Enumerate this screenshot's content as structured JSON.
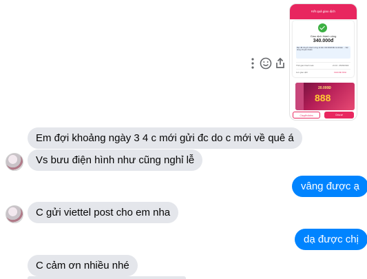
{
  "shared_image": {
    "header_title": "Kết quả giao dịch",
    "status": "Giao dịch thành công",
    "amount": "340.000đ",
    "note": "Bạn đã chuyển thành công số tiền 340.000đ đến tài khoản ... Nội dung chuyển khoản",
    "time_label": "Thời gian thanh toán",
    "time_value": "21:16 - 05/09/2022",
    "more_label": "Lưu giao dịch",
    "more_link": "CHIA SẺ ẢNH",
    "promo_amount": "20.000Đ",
    "promo_number": "888",
    "btn_transfer": "Chuyển thêm",
    "btn_share": "Chia sẻ"
  },
  "messages": [
    {
      "side": "in",
      "text": "Em đợi khoảng ngày 3 4 c mới gửi đc do c mới về quê á"
    },
    {
      "side": "in",
      "text": "Vs bưu điện hình như cũng nghỉ lễ"
    },
    {
      "side": "out",
      "text": "vâng được ạ"
    },
    {
      "side": "in",
      "text": "C gửi viettel post cho em nha"
    },
    {
      "side": "out",
      "text": "dạ được chị"
    },
    {
      "side": "in",
      "text": "C cảm ơn nhiều nhé"
    }
  ],
  "icons": {
    "more": "more-vertical-icon",
    "react": "emoji-icon",
    "share": "share-icon"
  },
  "colors": {
    "outgoing_bubble": "#0084ff",
    "incoming_bubble": "#e4e6eb",
    "brand": "#e8265f"
  }
}
